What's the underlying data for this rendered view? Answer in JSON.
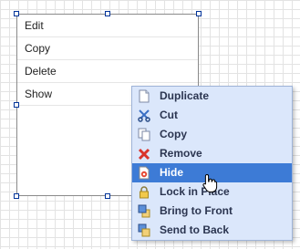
{
  "shape": {
    "rows": [
      "Edit",
      "Copy",
      "Delete",
      "Show"
    ]
  },
  "context_menu": {
    "items": [
      {
        "label": "Duplicate",
        "icon": "duplicate-icon"
      },
      {
        "label": "Cut",
        "icon": "cut-icon"
      },
      {
        "label": "Copy",
        "icon": "copy-icon"
      },
      {
        "label": "Remove",
        "icon": "remove-icon"
      },
      {
        "label": "Hide",
        "icon": "hide-icon",
        "active": true
      },
      {
        "label": "Lock in Place",
        "icon": "lock-icon"
      },
      {
        "label": "Bring to Front",
        "icon": "bring-to-front-icon"
      },
      {
        "label": "Send to Back",
        "icon": "send-to-back-icon"
      }
    ]
  },
  "colors": {
    "menu_background": "#dbe7fb",
    "menu_highlight": "#3d7bd6",
    "selection_handle": "#003399"
  }
}
